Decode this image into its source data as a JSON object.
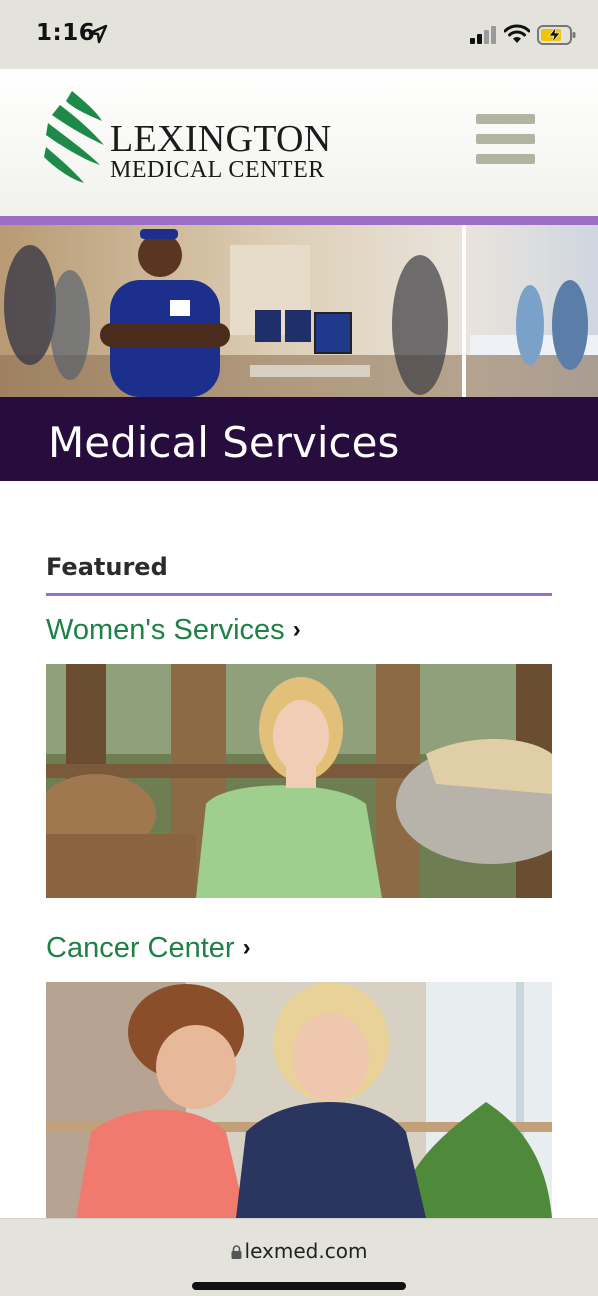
{
  "status_bar": {
    "time": "1:16",
    "icons": [
      "location-arrow-icon",
      "signal-icon",
      "wifi-icon",
      "battery-charging-icon"
    ]
  },
  "header": {
    "logo_line1": "LEXINGTON",
    "logo_line2": "MEDICAL CENTER",
    "logo_icon": "lexington-logo-mark",
    "menu_icon": "hamburger-menu-icon"
  },
  "hero": {
    "title": "Medical Services"
  },
  "featured": {
    "label": "Featured",
    "items": [
      {
        "label": "Women's Services",
        "chevron": "›",
        "image": "woman-with-horse-photo"
      },
      {
        "label": "Cancer Center",
        "chevron": "›",
        "image": "two-women-talking-photo"
      }
    ]
  },
  "browser": {
    "url": "lexmed.com"
  },
  "colors": {
    "accent_purple": "#9b6fc5",
    "hero_band": "#260d3d",
    "link_green": "#1e8145",
    "logo_green": "#1e8a4a"
  }
}
